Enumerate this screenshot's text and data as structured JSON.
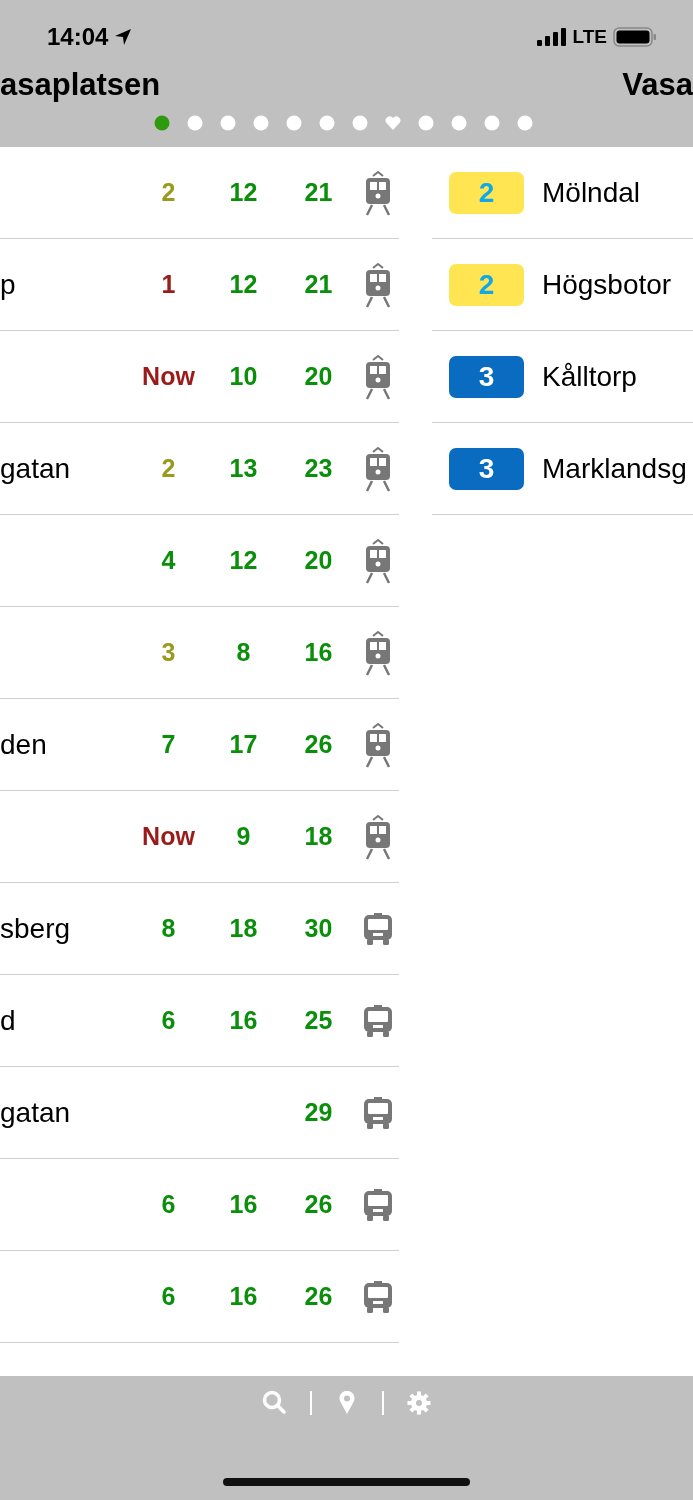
{
  "status_bar": {
    "time": "14:04",
    "network": "LTE"
  },
  "header": {
    "titles": [
      "asaplatsen",
      "Vasa"
    ],
    "page_dots": [
      {
        "kind": "dot",
        "selected": true
      },
      {
        "kind": "dot",
        "selected": false
      },
      {
        "kind": "dot",
        "selected": false
      },
      {
        "kind": "dot",
        "selected": false
      },
      {
        "kind": "dot",
        "selected": false
      },
      {
        "kind": "dot",
        "selected": false
      },
      {
        "kind": "dot",
        "selected": false
      },
      {
        "kind": "heart",
        "selected": false
      },
      {
        "kind": "dot",
        "selected": false
      },
      {
        "kind": "dot",
        "selected": false
      },
      {
        "kind": "dot",
        "selected": false
      },
      {
        "kind": "dot",
        "selected": false
      }
    ]
  },
  "departures": [
    {
      "kind": "tram",
      "times": [
        {
          "text": "2",
          "color": "#9a9a1e"
        },
        {
          "text": "12",
          "color": "#0a8f0a"
        },
        {
          "text": "21",
          "color": "#0a8f0a"
        }
      ]
    },
    {
      "destination": "p",
      "kind": "tram",
      "times": [
        {
          "text": "1",
          "color": "#9b1a1a"
        },
        {
          "text": "12",
          "color": "#0a8f0a"
        },
        {
          "text": "21",
          "color": "#0a8f0a"
        }
      ]
    },
    {
      "kind": "tram",
      "times": [
        {
          "text": "Now",
          "color": "#9b1a1a"
        },
        {
          "text": "10",
          "color": "#0a8f0a"
        },
        {
          "text": "20",
          "color": "#0a8f0a"
        }
      ]
    },
    {
      "destination": "gatan",
      "kind": "tram",
      "times": [
        {
          "text": "2",
          "color": "#9a9a1e"
        },
        {
          "text": "13",
          "color": "#0a8f0a"
        },
        {
          "text": "23",
          "color": "#0a8f0a"
        }
      ]
    },
    {
      "kind": "tram",
      "times": [
        {
          "text": "4",
          "color": "#0a8f0a"
        },
        {
          "text": "12",
          "color": "#0a8f0a"
        },
        {
          "text": "20",
          "color": "#0a8f0a"
        }
      ]
    },
    {
      "kind": "tram",
      "times": [
        {
          "text": "3",
          "color": "#9a9a1e"
        },
        {
          "text": "8",
          "color": "#0a8f0a"
        },
        {
          "text": "16",
          "color": "#0a8f0a"
        }
      ]
    },
    {
      "destination": "den",
      "kind": "tram",
      "times": [
        {
          "text": "7",
          "color": "#0a8f0a"
        },
        {
          "text": "17",
          "color": "#0a8f0a"
        },
        {
          "text": "26",
          "color": "#0a8f0a"
        }
      ]
    },
    {
      "kind": "tram",
      "times": [
        {
          "text": "Now",
          "color": "#9b1a1a"
        },
        {
          "text": "9",
          "color": "#0a8f0a"
        },
        {
          "text": "18",
          "color": "#0a8f0a"
        }
      ]
    },
    {
      "destination": "sberg",
      "kind": "bus",
      "times": [
        {
          "text": "8",
          "color": "#0a8f0a"
        },
        {
          "text": "18",
          "color": "#0a8f0a"
        },
        {
          "text": "30",
          "color": "#0a8f0a"
        }
      ]
    },
    {
      "destination": "d",
      "kind": "bus",
      "times": [
        {
          "text": "6",
          "color": "#0a8f0a"
        },
        {
          "text": "16",
          "color": "#0a8f0a"
        },
        {
          "text": "25",
          "color": "#0a8f0a"
        }
      ]
    },
    {
      "destination": "gatan",
      "kind": "bus",
      "times": [
        {
          "text": "29",
          "color": "#0a8f0a"
        }
      ]
    },
    {
      "kind": "bus",
      "times": [
        {
          "text": "6",
          "color": "#0a8f0a"
        },
        {
          "text": "16",
          "color": "#0a8f0a"
        },
        {
          "text": "26",
          "color": "#0a8f0a"
        }
      ]
    },
    {
      "kind": "bus",
      "times": [
        {
          "text": "6",
          "color": "#0a8f0a"
        },
        {
          "text": "16",
          "color": "#0a8f0a"
        },
        {
          "text": "26",
          "color": "#0a8f0a"
        }
      ]
    }
  ],
  "lines": [
    {
      "line": "2",
      "color": "#ffe552",
      "destination": "Mölndal"
    },
    {
      "line": "2",
      "color": "#ffe552",
      "destination": "Högsbotor"
    },
    {
      "line": "3",
      "color": "#0a6cc0",
      "destination": "Kålltorp"
    },
    {
      "line": "3",
      "color": "#0a6cc0",
      "destination": "Marklandsg"
    }
  ]
}
